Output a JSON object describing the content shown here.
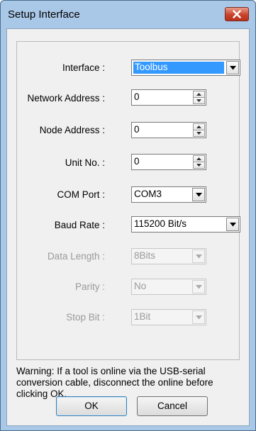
{
  "window": {
    "title": "Setup Interface"
  },
  "form": {
    "interface": {
      "label": "Interface :",
      "value": "Toolbus"
    },
    "network_address": {
      "label": "Network Address :",
      "value": "0"
    },
    "node_address": {
      "label": "Node Address :",
      "value": "0"
    },
    "unit_no": {
      "label": "Unit No. :",
      "value": "0"
    },
    "com_port": {
      "label": "COM Port :",
      "value": "COM3"
    },
    "baud_rate": {
      "label": "Baud Rate :",
      "value": "115200 Bit/s"
    },
    "data_length": {
      "label": "Data Length :",
      "value": "8Bits",
      "enabled": false
    },
    "parity": {
      "label": "Parity :",
      "value": "No",
      "enabled": false
    },
    "stop_bit": {
      "label": "Stop Bit :",
      "value": "1Bit",
      "enabled": false
    }
  },
  "warning_text": "Warning: If a tool is online via the USB-serial conversion cable, disconnect the online before clicking OK.",
  "buttons": {
    "ok": "OK",
    "cancel": "Cancel"
  },
  "icons": {
    "close": "close-icon",
    "dropdown": "chevron-down-icon",
    "spin_up": "arrow-up-icon",
    "spin_down": "arrow-down-icon"
  },
  "colors": {
    "selection": "#3399ff",
    "close_button": "#c9432b",
    "title_bar": "#a9c7e6"
  }
}
